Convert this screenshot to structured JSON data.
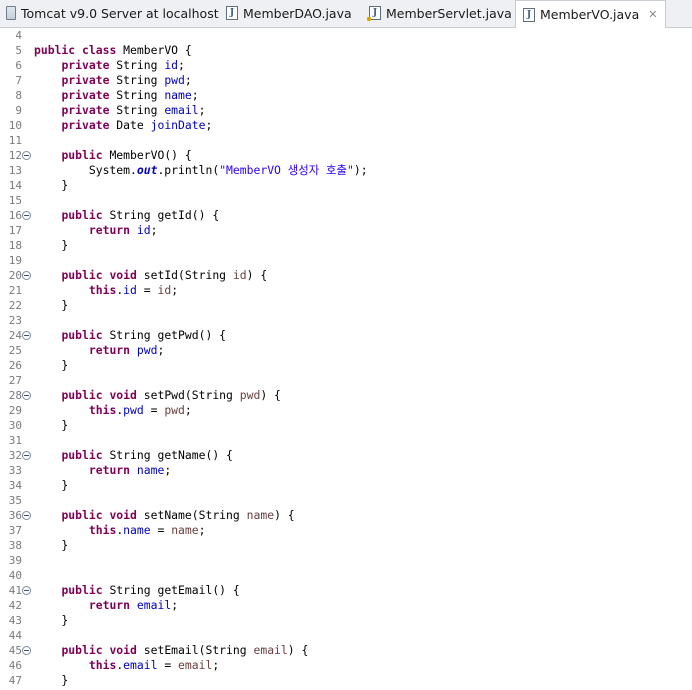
{
  "tabs": [
    {
      "label": "Tomcat v9.0 Server at localhost",
      "icon": "server-icon",
      "active": false
    },
    {
      "label": "MemberDAO.java",
      "icon": "java-file-icon",
      "active": false
    },
    {
      "label": "MemberServlet.java",
      "icon": "java-file-icon",
      "active": false
    },
    {
      "label": "MemberVO.java",
      "icon": "java-file-icon",
      "active": true,
      "close": "✕"
    }
  ],
  "editor": {
    "lines": [
      {
        "n": "4",
        "fold": false,
        "tokens": []
      },
      {
        "n": "5",
        "fold": false,
        "tokens": [
          [
            "kw",
            "public"
          ],
          [
            "p",
            " "
          ],
          [
            "kw",
            "class"
          ],
          [
            "p",
            " MemberVO {"
          ]
        ]
      },
      {
        "n": "6",
        "fold": false,
        "tokens": [
          [
            "p",
            "    "
          ],
          [
            "kw",
            "private"
          ],
          [
            "p",
            " String "
          ],
          [
            "fld",
            "id"
          ],
          [
            "p",
            ";"
          ]
        ]
      },
      {
        "n": "7",
        "fold": false,
        "tokens": [
          [
            "p",
            "    "
          ],
          [
            "kw",
            "private"
          ],
          [
            "p",
            " String "
          ],
          [
            "fld",
            "pwd"
          ],
          [
            "p",
            ";"
          ]
        ]
      },
      {
        "n": "8",
        "fold": false,
        "tokens": [
          [
            "p",
            "    "
          ],
          [
            "kw",
            "private"
          ],
          [
            "p",
            " String "
          ],
          [
            "fld",
            "name"
          ],
          [
            "p",
            ";"
          ]
        ]
      },
      {
        "n": "9",
        "fold": false,
        "tokens": [
          [
            "p",
            "    "
          ],
          [
            "kw",
            "private"
          ],
          [
            "p",
            " String "
          ],
          [
            "fld",
            "email"
          ],
          [
            "p",
            ";"
          ]
        ]
      },
      {
        "n": "10",
        "fold": false,
        "tokens": [
          [
            "p",
            "    "
          ],
          [
            "kw",
            "private"
          ],
          [
            "p",
            " Date "
          ],
          [
            "fld",
            "joinDate"
          ],
          [
            "p",
            ";"
          ]
        ]
      },
      {
        "n": "11",
        "fold": false,
        "tokens": []
      },
      {
        "n": "12",
        "fold": true,
        "tokens": [
          [
            "p",
            "    "
          ],
          [
            "kw",
            "public"
          ],
          [
            "p",
            " MemberVO() {"
          ]
        ]
      },
      {
        "n": "13",
        "fold": false,
        "tokens": [
          [
            "p",
            "        System."
          ],
          [
            "sfld",
            "out"
          ],
          [
            "p",
            ".println("
          ],
          [
            "str",
            "\"MemberVO 생성자 호출\""
          ],
          [
            "p",
            ");"
          ]
        ]
      },
      {
        "n": "14",
        "fold": false,
        "tokens": [
          [
            "p",
            "    }"
          ]
        ]
      },
      {
        "n": "15",
        "fold": false,
        "tokens": []
      },
      {
        "n": "16",
        "fold": true,
        "tokens": [
          [
            "p",
            "    "
          ],
          [
            "kw",
            "public"
          ],
          [
            "p",
            " String getId() {"
          ]
        ]
      },
      {
        "n": "17",
        "fold": false,
        "tokens": [
          [
            "p",
            "        "
          ],
          [
            "kw",
            "return"
          ],
          [
            "p",
            " "
          ],
          [
            "fld",
            "id"
          ],
          [
            "p",
            ";"
          ]
        ]
      },
      {
        "n": "18",
        "fold": false,
        "tokens": [
          [
            "p",
            "    }"
          ]
        ]
      },
      {
        "n": "19",
        "fold": false,
        "tokens": []
      },
      {
        "n": "20",
        "fold": true,
        "tokens": [
          [
            "p",
            "    "
          ],
          [
            "kw",
            "public"
          ],
          [
            "p",
            " "
          ],
          [
            "kw",
            "void"
          ],
          [
            "p",
            " setId(String "
          ],
          [
            "param",
            "id"
          ],
          [
            "p",
            ") {"
          ]
        ]
      },
      {
        "n": "21",
        "fold": false,
        "tokens": [
          [
            "p",
            "        "
          ],
          [
            "kw",
            "this"
          ],
          [
            "p",
            "."
          ],
          [
            "fld",
            "id"
          ],
          [
            "p",
            " = "
          ],
          [
            "param",
            "id"
          ],
          [
            "p",
            ";"
          ]
        ]
      },
      {
        "n": "22",
        "fold": false,
        "tokens": [
          [
            "p",
            "    }"
          ]
        ]
      },
      {
        "n": "23",
        "fold": false,
        "tokens": []
      },
      {
        "n": "24",
        "fold": true,
        "tokens": [
          [
            "p",
            "    "
          ],
          [
            "kw",
            "public"
          ],
          [
            "p",
            " String getPwd() {"
          ]
        ]
      },
      {
        "n": "25",
        "fold": false,
        "tokens": [
          [
            "p",
            "        "
          ],
          [
            "kw",
            "return"
          ],
          [
            "p",
            " "
          ],
          [
            "fld",
            "pwd"
          ],
          [
            "p",
            ";"
          ]
        ]
      },
      {
        "n": "26",
        "fold": false,
        "tokens": [
          [
            "p",
            "    }"
          ]
        ]
      },
      {
        "n": "27",
        "fold": false,
        "tokens": []
      },
      {
        "n": "28",
        "fold": true,
        "tokens": [
          [
            "p",
            "    "
          ],
          [
            "kw",
            "public"
          ],
          [
            "p",
            " "
          ],
          [
            "kw",
            "void"
          ],
          [
            "p",
            " setPwd(String "
          ],
          [
            "param",
            "pwd"
          ],
          [
            "p",
            ") {"
          ]
        ]
      },
      {
        "n": "29",
        "fold": false,
        "tokens": [
          [
            "p",
            "        "
          ],
          [
            "kw",
            "this"
          ],
          [
            "p",
            "."
          ],
          [
            "fld",
            "pwd"
          ],
          [
            "p",
            " = "
          ],
          [
            "param",
            "pwd"
          ],
          [
            "p",
            ";"
          ]
        ]
      },
      {
        "n": "30",
        "fold": false,
        "tokens": [
          [
            "p",
            "    }"
          ]
        ]
      },
      {
        "n": "31",
        "fold": false,
        "tokens": []
      },
      {
        "n": "32",
        "fold": true,
        "tokens": [
          [
            "p",
            "    "
          ],
          [
            "kw",
            "public"
          ],
          [
            "p",
            " String getName() {"
          ]
        ]
      },
      {
        "n": "33",
        "fold": false,
        "tokens": [
          [
            "p",
            "        "
          ],
          [
            "kw",
            "return"
          ],
          [
            "p",
            " "
          ],
          [
            "fld",
            "name"
          ],
          [
            "p",
            ";"
          ]
        ]
      },
      {
        "n": "34",
        "fold": false,
        "tokens": [
          [
            "p",
            "    }"
          ]
        ]
      },
      {
        "n": "35",
        "fold": false,
        "tokens": []
      },
      {
        "n": "36",
        "fold": true,
        "tokens": [
          [
            "p",
            "    "
          ],
          [
            "kw",
            "public"
          ],
          [
            "p",
            " "
          ],
          [
            "kw",
            "void"
          ],
          [
            "p",
            " setName(String "
          ],
          [
            "param",
            "name"
          ],
          [
            "p",
            ") {"
          ]
        ]
      },
      {
        "n": "37",
        "fold": false,
        "tokens": [
          [
            "p",
            "        "
          ],
          [
            "kw",
            "this"
          ],
          [
            "p",
            "."
          ],
          [
            "fld",
            "name"
          ],
          [
            "p",
            " = "
          ],
          [
            "param",
            "name"
          ],
          [
            "p",
            ";"
          ]
        ]
      },
      {
        "n": "38",
        "fold": false,
        "tokens": [
          [
            "p",
            "    }"
          ]
        ]
      },
      {
        "n": "39",
        "fold": false,
        "tokens": []
      },
      {
        "n": "40",
        "fold": false,
        "tokens": []
      },
      {
        "n": "41",
        "fold": true,
        "tokens": [
          [
            "p",
            "    "
          ],
          [
            "kw",
            "public"
          ],
          [
            "p",
            " String getEmail() {"
          ]
        ]
      },
      {
        "n": "42",
        "fold": false,
        "tokens": [
          [
            "p",
            "        "
          ],
          [
            "kw",
            "return"
          ],
          [
            "p",
            " "
          ],
          [
            "fld",
            "email"
          ],
          [
            "p",
            ";"
          ]
        ]
      },
      {
        "n": "43",
        "fold": false,
        "tokens": [
          [
            "p",
            "    }"
          ]
        ]
      },
      {
        "n": "44",
        "fold": false,
        "tokens": []
      },
      {
        "n": "45",
        "fold": true,
        "tokens": [
          [
            "p",
            "    "
          ],
          [
            "kw",
            "public"
          ],
          [
            "p",
            " "
          ],
          [
            "kw",
            "void"
          ],
          [
            "p",
            " setEmail(String "
          ],
          [
            "param",
            "email"
          ],
          [
            "p",
            ") {"
          ]
        ]
      },
      {
        "n": "46",
        "fold": false,
        "tokens": [
          [
            "p",
            "        "
          ],
          [
            "kw",
            "this"
          ],
          [
            "p",
            "."
          ],
          [
            "fld",
            "email"
          ],
          [
            "p",
            " = "
          ],
          [
            "param",
            "email"
          ],
          [
            "p",
            ";"
          ]
        ]
      },
      {
        "n": "47",
        "fold": false,
        "tokens": [
          [
            "p",
            "    }"
          ]
        ]
      }
    ]
  }
}
